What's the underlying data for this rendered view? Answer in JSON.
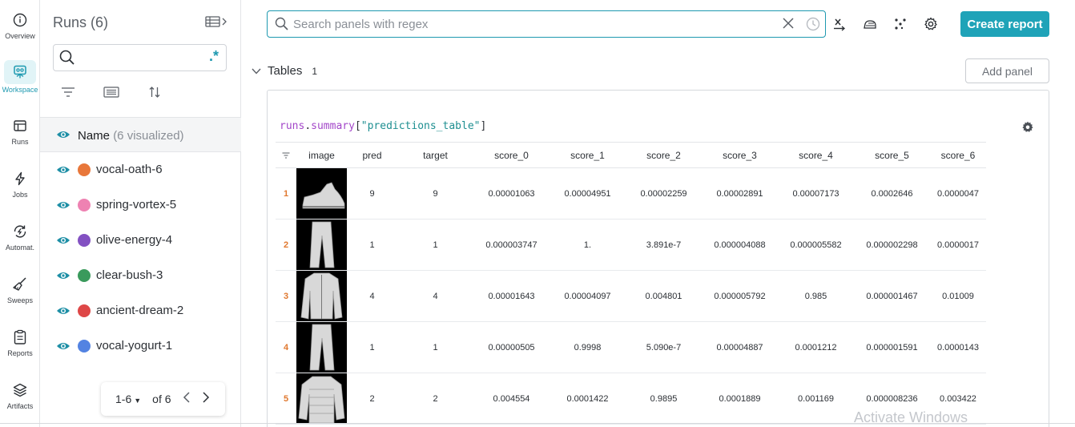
{
  "nav": {
    "items": [
      {
        "label": "Overview",
        "icon": "info-icon"
      },
      {
        "label": "Workspace",
        "icon": "workspace-icon",
        "active": true
      },
      {
        "label": "Runs",
        "icon": "table-icon"
      },
      {
        "label": "Jobs",
        "icon": "lightning-icon"
      },
      {
        "label": "Automat.",
        "icon": "automation-icon"
      },
      {
        "label": "Sweeps",
        "icon": "broom-icon"
      },
      {
        "label": "Reports",
        "icon": "clipboard-icon"
      },
      {
        "label": "Artifacts",
        "icon": "layers-icon"
      }
    ]
  },
  "runs": {
    "title": "Runs (6)",
    "search_placeholder": "",
    "regex_label": ".*",
    "header_name": "Name",
    "header_visualized": "(6 visualized)",
    "items": [
      {
        "name": "vocal-oath-6",
        "color": "#e8773a"
      },
      {
        "name": "spring-vortex-5",
        "color": "#ee82b2"
      },
      {
        "name": "olive-energy-4",
        "color": "#8351c2"
      },
      {
        "name": "clear-bush-3",
        "color": "#3a9a5c"
      },
      {
        "name": "ancient-dream-2",
        "color": "#de4747"
      },
      {
        "name": "vocal-yogurt-1",
        "color": "#5383e2"
      }
    ],
    "pager": {
      "range": "1-6",
      "of": "of 6"
    }
  },
  "topbar": {
    "search_placeholder": "Search panels with regex",
    "create_report": "Create report"
  },
  "section": {
    "title": "Tables",
    "count": "1",
    "add_panel": "Add panel"
  },
  "panel": {
    "query_prefix": "runs",
    "query_dot": ".",
    "query_fn": "summary",
    "query_open": "[",
    "query_key": "\"predictions_table\"",
    "query_close": "]",
    "columns": [
      "image",
      "pred",
      "target",
      "score_0",
      "score_1",
      "score_2",
      "score_3",
      "score_4",
      "score_5",
      "score_6"
    ],
    "rows": [
      {
        "idx": "1",
        "image": "ankle-boot",
        "cells": [
          "9",
          "9",
          "0.00001063",
          "0.00004951",
          "0.00002259",
          "0.00002891",
          "0.00007173",
          "0.0002646",
          "0.0000047"
        ]
      },
      {
        "idx": "2",
        "image": "trouser",
        "cells": [
          "1",
          "1",
          "0.000003747",
          "1.",
          "3.891e-7",
          "0.000004088",
          "0.000005582",
          "0.000002298",
          "0.0000017"
        ]
      },
      {
        "idx": "3",
        "image": "coat",
        "cells": [
          "4",
          "4",
          "0.00001643",
          "0.00004097",
          "0.004801",
          "0.000005792",
          "0.985",
          "0.000001467",
          "0.01009"
        ]
      },
      {
        "idx": "4",
        "image": "trouser",
        "cells": [
          "1",
          "1",
          "0.00000505",
          "0.9998",
          "5.090e-7",
          "0.00004887",
          "0.0001212",
          "0.000001591",
          "0.0000143"
        ]
      },
      {
        "idx": "5",
        "image": "pullover",
        "cells": [
          "2",
          "2",
          "0.004554",
          "0.0001422",
          "0.9895",
          "0.0001889",
          "0.001169",
          "0.000008236",
          "0.003422"
        ]
      }
    ]
  },
  "watermark": "Activate Windows"
}
